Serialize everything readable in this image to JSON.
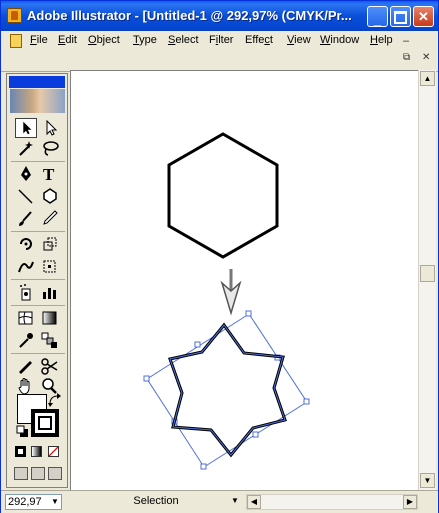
{
  "window": {
    "title": "Adobe Illustrator - [Untitled-1 @ 292,97% (CMYK/Pr...",
    "minimize_label": "_",
    "close_label": "✕"
  },
  "menu": {
    "items": [
      {
        "label": "File",
        "key": "F"
      },
      {
        "label": "Edit",
        "key": "E"
      },
      {
        "label": "Object",
        "key": "O"
      },
      {
        "label": "Type",
        "key": "T"
      },
      {
        "label": "Select",
        "key": "S"
      },
      {
        "label": "Filter",
        "key": "i"
      },
      {
        "label": "Effect",
        "key": "c"
      },
      {
        "label": "View",
        "key": "V"
      },
      {
        "label": "Window",
        "key": "W"
      },
      {
        "label": "Help",
        "key": "H"
      }
    ],
    "doc_minimize": "–",
    "doc_restore": "⧉",
    "doc_close": "✕"
  },
  "statusbar": {
    "zoom": "292,97",
    "status": "Selection"
  },
  "icons": {
    "selection": "selection-icon",
    "direct_selection": "direct-selection-icon",
    "magic_wand": "magic-wand-icon",
    "lasso": "lasso-icon",
    "pen": "pen-icon",
    "type": "type-icon",
    "line": "line-segment-icon",
    "ellipse": "ellipse-icon",
    "paintbrush": "paintbrush-icon",
    "pencil": "pencil-icon",
    "rotate": "rotate-icon",
    "scale": "scale-icon",
    "warp": "warp-icon",
    "free_transform": "free-transform-icon",
    "symbol_sprayer": "symbol-sprayer-icon",
    "graph": "column-graph-icon",
    "mesh": "mesh-icon",
    "gradient": "gradient-icon",
    "eyedropper": "eyedropper-icon",
    "blend": "blend-icon",
    "slice": "slice-icon",
    "scissors": "scissors-icon",
    "hand": "hand-icon",
    "zoom": "zoom-icon"
  },
  "colors": {
    "selection_blue": "#4f6fd8",
    "titlebar": "#0a4fd8"
  }
}
